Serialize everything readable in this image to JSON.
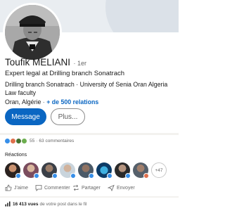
{
  "profile": {
    "name": "Toufik MELIANI",
    "degree": "· 1er",
    "headline": "Expert legal at Drilling branch Sonatrach",
    "education": "Drilling branch Sonatrach · University of Senia Oran Algeria Law faculty",
    "location": "Oran, Algérie",
    "separator": "·",
    "connections": "+ de 500 relations"
  },
  "buttons": {
    "message": "Message",
    "more": "Plus..."
  },
  "post": {
    "reaction_count": "55",
    "separator": "·",
    "comments": "63 commentaires",
    "reactions_title": "Réactions",
    "more_reactors": "+47",
    "reaction_icons": [
      "like-icon",
      "love-icon",
      "celebrate-icon",
      "support-icon"
    ],
    "reaction_colors": [
      "#378fe9",
      "#df704d",
      "#44712e",
      "#6dae4f"
    ],
    "reactor_badges": [
      "like-badge",
      "like-badge",
      "like-badge",
      "like-badge",
      "like-badge",
      "like-badge",
      "like-badge",
      "love-badge"
    ]
  },
  "actions": {
    "like": "J'aime",
    "comment": "Commenter",
    "share": "Partager",
    "send": "Envoyer"
  },
  "stats": {
    "views_count": "16 413 vues",
    "views_suffix": "de votre post dans le fil"
  },
  "colors": {
    "brand_blue": "#0a66c2",
    "like_blue": "#378fe9",
    "text_muted": "#666666"
  }
}
